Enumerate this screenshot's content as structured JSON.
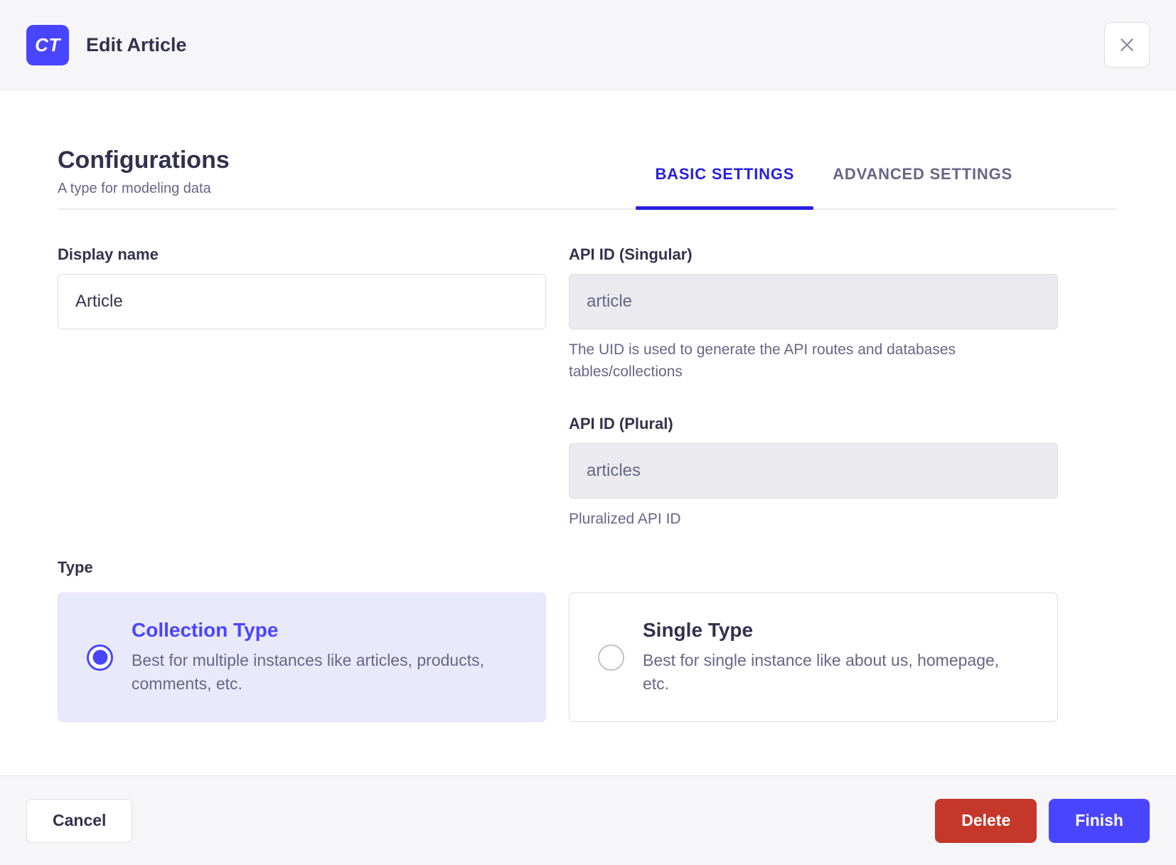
{
  "header": {
    "badge": "CT",
    "title": "Edit Article"
  },
  "config": {
    "title": "Configurations",
    "subtitle": "A type for modeling data",
    "tabs": [
      {
        "label": "BASIC SETTINGS",
        "active": true
      },
      {
        "label": "ADVANCED SETTINGS",
        "active": false
      }
    ]
  },
  "form": {
    "display_name": {
      "label": "Display name",
      "value": "Article"
    },
    "api_id_singular": {
      "label": "API ID (Singular)",
      "value": "article",
      "hint": "The UID is used to generate the API routes and databases tables/collections"
    },
    "api_id_plural": {
      "label": "API ID (Plural)",
      "value": "articles",
      "hint": "Pluralized API ID"
    },
    "type": {
      "label": "Type",
      "options": [
        {
          "title": "Collection Type",
          "description": "Best for multiple instances like articles, products, comments, etc.",
          "selected": true
        },
        {
          "title": "Single Type",
          "description": "Best for single instance like about us, homepage, etc.",
          "selected": false
        }
      ]
    }
  },
  "footer": {
    "cancel_label": "Cancel",
    "delete_label": "Delete",
    "finish_label": "Finish"
  },
  "colors": {
    "accent": "#4945ff",
    "tab_active": "#271fe0",
    "danger": "#c5362b",
    "selected_card_bg": "#e9e9fc",
    "header_bg": "#f6f6f9",
    "text_dark": "#32324d",
    "text_muted": "#666687"
  }
}
